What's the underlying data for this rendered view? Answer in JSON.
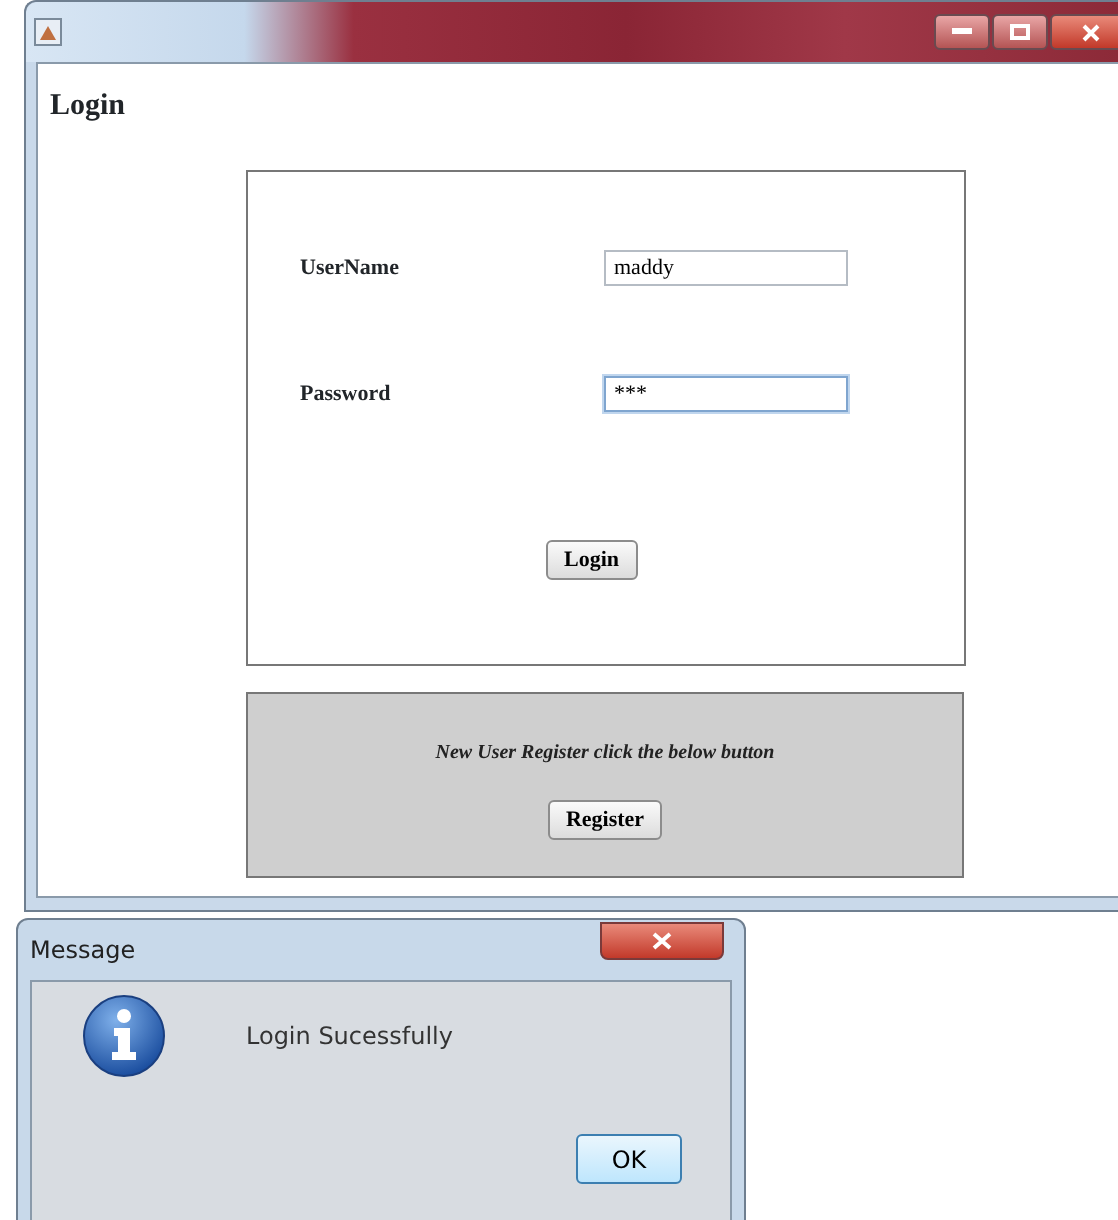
{
  "main_window": {
    "heading": "Login",
    "form": {
      "fields": [
        {
          "label": "UserName",
          "value": "maddy",
          "focused": false
        },
        {
          "label": "Password",
          "value": "***",
          "focused": true
        }
      ],
      "submit": "Login"
    },
    "register_panel": {
      "prompt": "New User Register click the below button",
      "button": "Register"
    }
  },
  "dialog": {
    "title": "Message",
    "message": "Login Sucessfully",
    "button": "OK"
  }
}
